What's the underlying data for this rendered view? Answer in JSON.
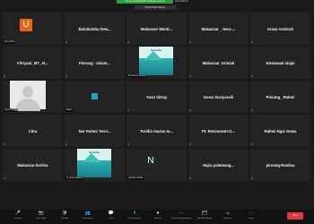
{
  "top": {
    "banner": "You are viewing Rahmi Hidayat's screen",
    "banner_right": "View Options",
    "speaker": "MAKASSAR Talking:"
  },
  "tiles": [
    {
      "row": 0,
      "col": 0,
      "type": "letter",
      "letter": "U",
      "color": "#e8641a",
      "tag": "Upe Rahim"
    },
    {
      "row": 0,
      "col": 1,
      "type": "name",
      "name": "Bulukumba Dew..."
    },
    {
      "row": 0,
      "col": 2,
      "type": "name",
      "name": "Makassar Wanti..."
    },
    {
      "row": 0,
      "col": 3,
      "type": "name",
      "name": "Makassar _ Hera ..."
    },
    {
      "row": 0,
      "col": 4,
      "type": "name",
      "name": "Gowa Asmirah"
    },
    {
      "row": 1,
      "col": 0,
      "type": "name",
      "name": "Fitriyani_MT_Al..."
    },
    {
      "row": 1,
      "col": 1,
      "type": "name",
      "name": "Pinrang - Isham..."
    },
    {
      "row": 1,
      "col": 2,
      "type": "logo",
      "logo": "Bercerita",
      "tag": "PK.kedeng-Sukses"
    },
    {
      "row": 1,
      "col": 3,
      "type": "name",
      "name": "Makassar_Ermiati"
    },
    {
      "row": 1,
      "col": 4,
      "type": "name",
      "name": "Nirmawati sinjai"
    },
    {
      "row": 2,
      "col": 0,
      "type": "portrait",
      "tag": "Diyah_sfinjai"
    },
    {
      "row": 2,
      "col": 1,
      "type": "square",
      "tag": "Mhjeb"
    },
    {
      "row": 2,
      "col": 2,
      "type": "name",
      "name": "Yusri tidrap"
    },
    {
      "row": 2,
      "col": 3,
      "type": "name",
      "name": "Gowa Suciyarsih"
    },
    {
      "row": 2,
      "col": 4,
      "type": "name",
      "name": "Pinrang_ Rahmi"
    },
    {
      "row": 3,
      "col": 0,
      "type": "name",
      "name": "Citra"
    },
    {
      "row": 3,
      "col": 1,
      "type": "name",
      "name": "Nur Rahmi Terni..."
    },
    {
      "row": 3,
      "col": 2,
      "type": "name",
      "name": "Toridin masna ta..."
    },
    {
      "row": 3,
      "col": 3,
      "type": "name",
      "name": "Pt. Resmuwati-G..."
    },
    {
      "row": 3,
      "col": 4,
      "type": "name",
      "name": "Rahmi Ngai Gowa"
    },
    {
      "row": 4,
      "col": 0,
      "type": "name",
      "name": "Makassar-herlina"
    },
    {
      "row": 4,
      "col": 1,
      "type": "logo",
      "logo": "Bercerita",
      "tag": "ni_unik belajaran"
    },
    {
      "row": 4,
      "col": 2,
      "type": "letter",
      "letter": "N",
      "color": "#1e2a2a",
      "tag": "pangkal nafilda"
    },
    {
      "row": 4,
      "col": 3,
      "type": "name",
      "name": "Hajra paleteang..."
    },
    {
      "row": 4,
      "col": 4,
      "type": "name",
      "name": "pinrang-Roslina"
    }
  ],
  "toolbar": [
    {
      "icon": "🎤",
      "label": "Unmute"
    },
    {
      "icon": "📷",
      "label": "Start Video"
    },
    {
      "icon": "🛡",
      "label": "Security"
    },
    {
      "icon": "👥",
      "label": "Participants"
    },
    {
      "icon": "💬",
      "label": "Chat"
    },
    {
      "icon": "⬆",
      "label": "Share Screen"
    },
    {
      "icon": "⏺",
      "label": "Record"
    },
    {
      "icon": "⋯",
      "label": "Pause/Stop Recording"
    },
    {
      "icon": "🗂",
      "label": "Breakout Rooms"
    },
    {
      "icon": "☺",
      "label": "Reactions"
    },
    {
      "icon": "⋯",
      "label": "More"
    }
  ],
  "end_label": "End"
}
